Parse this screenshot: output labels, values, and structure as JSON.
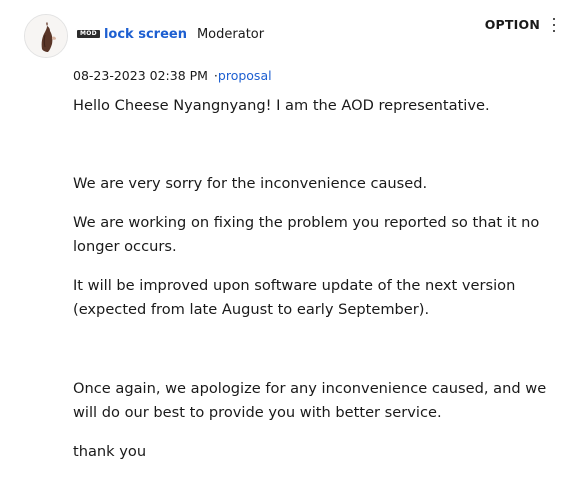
{
  "post": {
    "author": {
      "badge": "MOD",
      "username": "lock screen",
      "role": "Moderator"
    },
    "option_label": "OPTION",
    "meta": {
      "datetime": "08-23-2023 02:38 PM",
      "separator": "·",
      "label": "proposal"
    },
    "body": [
      "Hello Cheese Nyangnyang! I am the AOD representative.",
      "We are very sorry for the inconvenience caused.",
      "We are working on fixing the problem you reported so that it no longer occurs.",
      "It will be improved upon software update of the next version (expected from late August to early September).",
      "Once again, we apologize for any inconvenience caused, and we will do our best to provide you with better service.",
      "thank you"
    ]
  },
  "icons": {
    "avatar": "user-avatar-image",
    "options": "kebab-menu-icon"
  },
  "colors": {
    "link_blue": "#1d5fd1",
    "text": "#1a1a1a",
    "badge_bg": "#2b2b2b"
  }
}
